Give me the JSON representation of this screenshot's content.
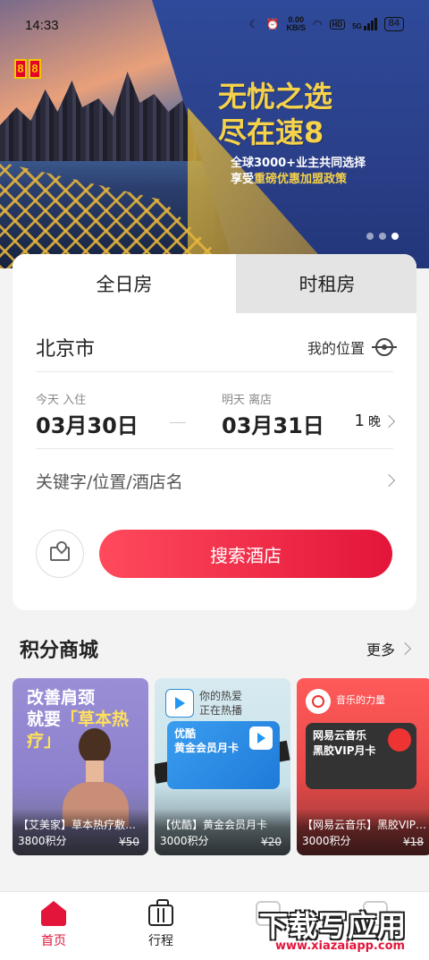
{
  "status_bar": {
    "time": "14:33",
    "net_speed_value": "0.00",
    "net_speed_unit": "KB/S",
    "hd": "HD",
    "signal": "5G",
    "battery": "84"
  },
  "banner": {
    "brand": [
      "8",
      "8"
    ],
    "headline_line1": "无忧之选",
    "headline_line2": "尽在速8",
    "sub_line1": "全球3000+业主共同选择",
    "sub_line2_prefix": "享受",
    "sub_line2_highlight": "重磅优惠加盟政策",
    "active_dot": 3,
    "dot_count": 3
  },
  "booking": {
    "tabs": [
      {
        "label": "全日房",
        "active": true
      },
      {
        "label": "时租房",
        "active": false
      }
    ],
    "city": "北京市",
    "my_location": "我的位置",
    "checkin_label": "今天 入住",
    "checkin_date": "03月30日",
    "checkout_label": "明天 离店",
    "checkout_date": "03月31日",
    "nights_count": "1",
    "nights_unit": "晚",
    "keyword_placeholder": "关键字/位置/酒店名",
    "search_button": "搜索酒店"
  },
  "mall": {
    "title": "积分商城",
    "more": "更多",
    "products": [
      {
        "name": "【艾美家】草本热疗敷颈...",
        "points": "3800积分",
        "original_price": "¥50",
        "art_line1": "改善肩颈",
        "art_line2_prefix": "就要",
        "art_line2_highlight": "「草本热疗」"
      },
      {
        "name": "【优酷】黄金会员月卡",
        "points": "3000积分",
        "original_price": "¥20",
        "slogan_line1": "你的热爱",
        "slogan_line2": "正在热播",
        "card_line1": "优酷",
        "card_line2": "黄金会员月卡"
      },
      {
        "name": "【网易云音乐】黑胶VIP月卡",
        "points": "3000积分",
        "original_price": "¥18",
        "slogan": "音乐的力量",
        "card_line1": "网易云音乐",
        "card_line2": "黑胶VIP月卡"
      }
    ]
  },
  "bottom_nav": [
    {
      "label": "首页",
      "active": true
    },
    {
      "label": "行程",
      "active": false
    }
  ],
  "watermark": {
    "big": "下载写应用",
    "small": "www.xiazaiapp.com"
  },
  "colors": {
    "accent": "#e3153a",
    "banner_headline": "#f6d24a"
  }
}
